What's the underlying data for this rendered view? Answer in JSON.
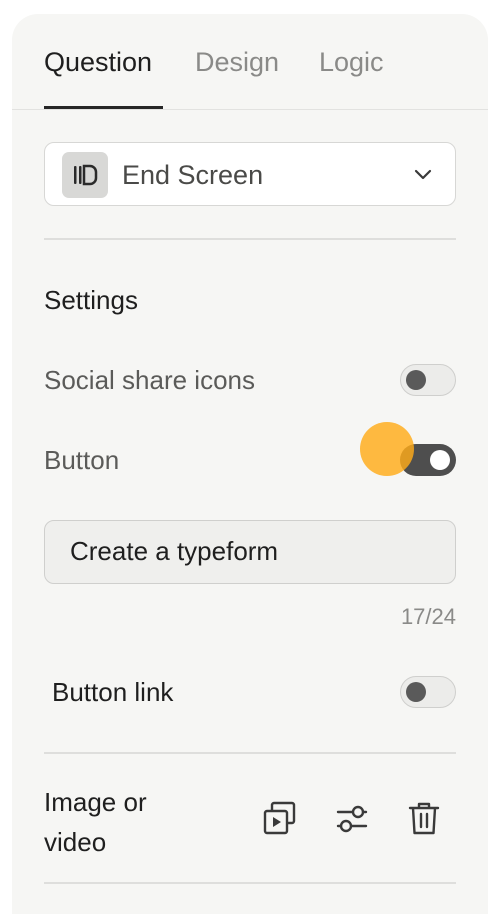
{
  "tabs": {
    "items": [
      {
        "label": "Question",
        "active": true
      },
      {
        "label": "Design",
        "active": false
      },
      {
        "label": "Logic",
        "active": false
      }
    ]
  },
  "question_type": {
    "selected": "End Screen",
    "icon": "end-screen-icon"
  },
  "settings": {
    "heading": "Settings",
    "social_share": {
      "label": "Social share icons",
      "enabled": false
    },
    "button": {
      "label": "Button",
      "enabled": true
    },
    "button_text": {
      "value": "Create a typeform",
      "counter": "17/24"
    },
    "button_link": {
      "label": "Button link",
      "enabled": false
    }
  },
  "media": {
    "label_line1": "Image or",
    "label_line2": "video",
    "actions": [
      "media-gallery-icon",
      "adjust-sliders-icon",
      "trash-icon"
    ]
  },
  "colors": {
    "panel_bg": "#f6f6f4",
    "toggle_on": "#4e4e4e",
    "cursor_highlight": "#ffab19"
  }
}
